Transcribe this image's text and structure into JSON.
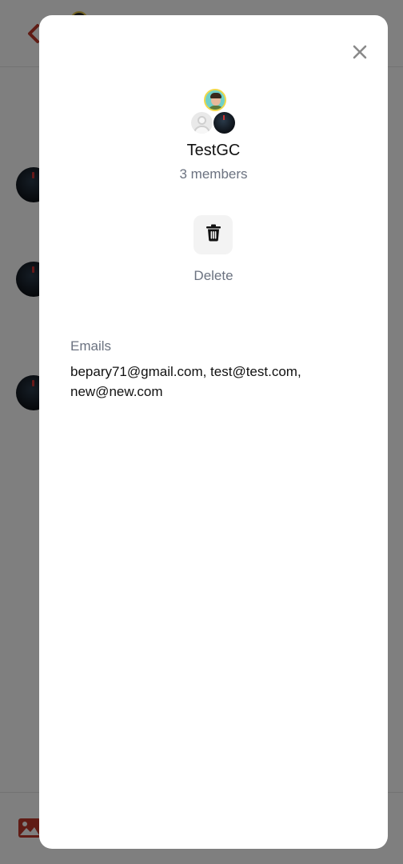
{
  "modal": {
    "group_name": "TestGC",
    "member_count": "3 members",
    "delete_label": "Delete",
    "emails_label": "Emails",
    "emails_value": "bepary71@gmail.com, test@test.com, new@new.com"
  },
  "icons": {
    "close": "close-icon",
    "delete": "trash-icon",
    "back": "chevron-left-icon",
    "image": "image-icon"
  },
  "colors": {
    "accent": "#c0392b",
    "text_primary": "#111111",
    "text_secondary": "#6b7280",
    "button_bg": "#f3f3f3"
  }
}
